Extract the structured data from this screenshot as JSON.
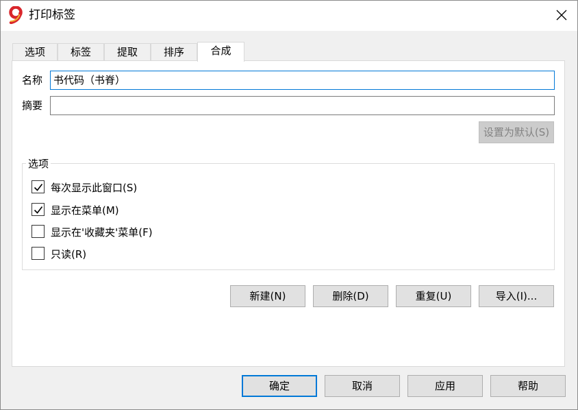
{
  "window": {
    "title": "打印标签"
  },
  "tabs": [
    {
      "label": "选项"
    },
    {
      "label": "标签"
    },
    {
      "label": "提取"
    },
    {
      "label": "排序"
    },
    {
      "label": "合成"
    }
  ],
  "form": {
    "name_label": "名称",
    "name_value": "书代码（书脊）",
    "summary_label": "摘要",
    "summary_value": "",
    "set_default_label": "设置为默认(S)"
  },
  "options_group": {
    "title": "选项",
    "items": [
      {
        "label": "每次显示此窗口(S)",
        "checked": true
      },
      {
        "label": "显示在菜单(M)",
        "checked": true
      },
      {
        "label": "显示在'收藏夹'菜单(F)",
        "checked": false
      },
      {
        "label": "只读(R)",
        "checked": false
      }
    ]
  },
  "actions": {
    "new_label": "新建(N)",
    "delete_label": "删除(D)",
    "reset_label": "重复(U)",
    "import_label": "导入(I)..."
  },
  "footer": {
    "ok_label": "确定",
    "cancel_label": "取消",
    "apply_label": "应用",
    "help_label": "帮助"
  },
  "colors": {
    "accent": "#0078d7",
    "app_icon": "#d9262c"
  }
}
